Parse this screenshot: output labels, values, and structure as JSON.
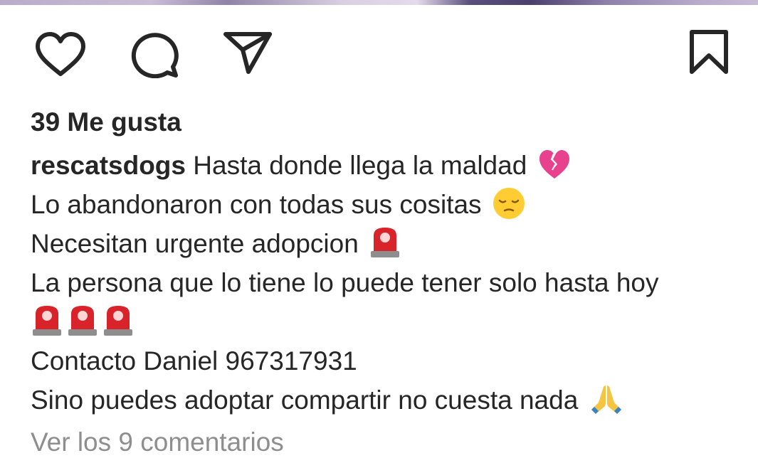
{
  "post": {
    "likes_label": "39 Me gusta",
    "username": "rescatsdogs",
    "caption_lines": [
      "Hasta donde llega la maldad",
      "Lo abandonaron con todas sus cositas",
      "Necesitan urgente adopcion",
      "La persona que lo tiene lo puede tener solo hasta hoy",
      "",
      "Contacto Daniel 967317931",
      "Sino puedes adoptar compartir no cuesta nada"
    ],
    "view_comments_label": "Ver los 9 comentarios"
  },
  "icons": {
    "like": "heart-icon",
    "comment": "comment-bubble-icon",
    "share": "paper-plane-icon",
    "save": "bookmark-icon"
  },
  "emojis": {
    "line1": "broken-heart-emoji",
    "line2": "pensive-face-emoji",
    "line3": "police-light-emoji",
    "line5": [
      "police-light-emoji",
      "police-light-emoji",
      "police-light-emoji"
    ],
    "line7": "folded-hands-emoji"
  },
  "colors": {
    "text": "#262626",
    "muted": "#8e8e8e",
    "background": "#ffffff"
  }
}
